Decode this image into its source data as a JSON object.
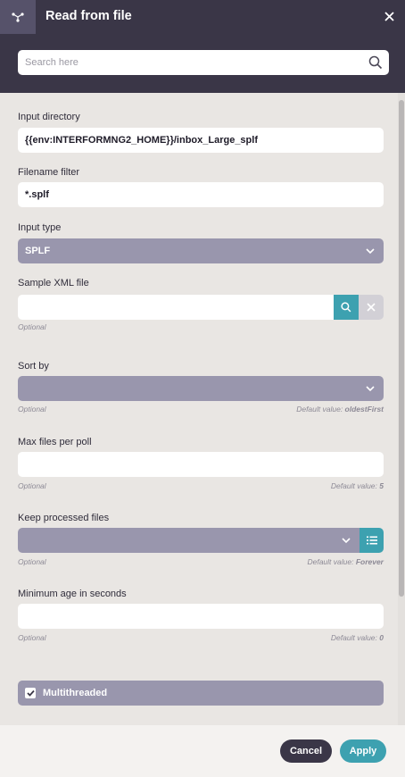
{
  "header": {
    "title": "Read from file",
    "icon": "route-icon",
    "close_icon": "close-icon"
  },
  "search": {
    "placeholder": "Search here",
    "value": ""
  },
  "form": {
    "input_directory": {
      "label": "Input directory",
      "value": "{{env:INTERFORMNG2_HOME}}/inbox_Large_splf"
    },
    "filename_filter": {
      "label": "Filename filter",
      "value": "*.splf"
    },
    "input_type": {
      "label": "Input type",
      "value": "SPLF"
    },
    "sample_xml": {
      "label": "Sample XML file",
      "value": "",
      "hint": "Optional"
    },
    "sort_by": {
      "label": "Sort by",
      "value": "",
      "hint": "Optional",
      "default_prefix": "Default value: ",
      "default_value": "oldestFirst"
    },
    "max_files": {
      "label": "Max files per poll",
      "value": "",
      "hint": "Optional",
      "default_prefix": "Default value: ",
      "default_value": "5"
    },
    "keep_processed": {
      "label": "Keep processed files",
      "value": "",
      "hint": "Optional",
      "default_prefix": "Default value: ",
      "default_value": "Forever"
    },
    "min_age": {
      "label": "Minimum age in seconds",
      "value": "",
      "hint": "Optional",
      "default_prefix": "Default value: ",
      "default_value": "0"
    },
    "multithreaded": {
      "label": "Multithreaded",
      "checked": true
    }
  },
  "footer": {
    "cancel_label": "Cancel",
    "apply_label": "Apply"
  },
  "colors": {
    "header_bg": "#3a3647",
    "accent": "#3da1b0",
    "select_bg": "#9996ad",
    "panel_bg": "#e9e6e3"
  }
}
